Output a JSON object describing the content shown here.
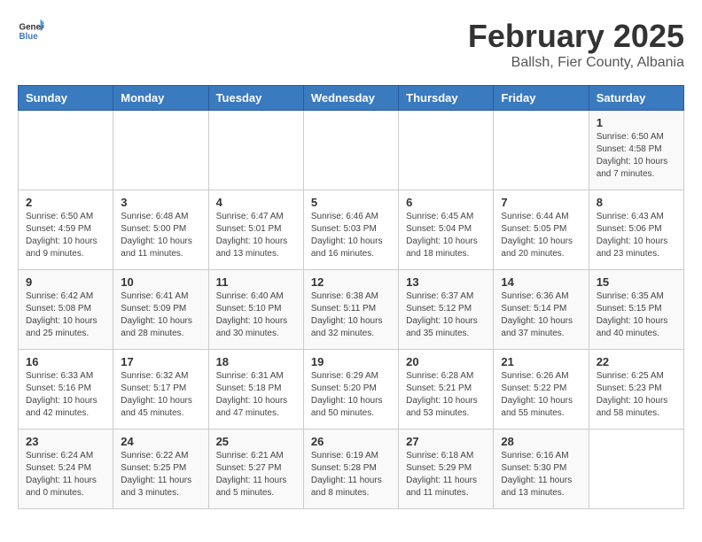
{
  "header": {
    "logo": {
      "general": "General",
      "blue": "Blue"
    },
    "title": "February 2025",
    "subtitle": "Ballsh, Fier County, Albania"
  },
  "weekdays": [
    "Sunday",
    "Monday",
    "Tuesday",
    "Wednesday",
    "Thursday",
    "Friday",
    "Saturday"
  ],
  "weeks": [
    [
      {
        "day": "",
        "info": ""
      },
      {
        "day": "",
        "info": ""
      },
      {
        "day": "",
        "info": ""
      },
      {
        "day": "",
        "info": ""
      },
      {
        "day": "",
        "info": ""
      },
      {
        "day": "",
        "info": ""
      },
      {
        "day": "1",
        "info": "Sunrise: 6:50 AM\nSunset: 4:58 PM\nDaylight: 10 hours\nand 7 minutes."
      }
    ],
    [
      {
        "day": "2",
        "info": "Sunrise: 6:50 AM\nSunset: 4:59 PM\nDaylight: 10 hours\nand 9 minutes."
      },
      {
        "day": "3",
        "info": "Sunrise: 6:48 AM\nSunset: 5:00 PM\nDaylight: 10 hours\nand 11 minutes."
      },
      {
        "day": "4",
        "info": "Sunrise: 6:47 AM\nSunset: 5:01 PM\nDaylight: 10 hours\nand 13 minutes."
      },
      {
        "day": "5",
        "info": "Sunrise: 6:46 AM\nSunset: 5:03 PM\nDaylight: 10 hours\nand 16 minutes."
      },
      {
        "day": "6",
        "info": "Sunrise: 6:45 AM\nSunset: 5:04 PM\nDaylight: 10 hours\nand 18 minutes."
      },
      {
        "day": "7",
        "info": "Sunrise: 6:44 AM\nSunset: 5:05 PM\nDaylight: 10 hours\nand 20 minutes."
      },
      {
        "day": "8",
        "info": "Sunrise: 6:43 AM\nSunset: 5:06 PM\nDaylight: 10 hours\nand 23 minutes."
      }
    ],
    [
      {
        "day": "9",
        "info": "Sunrise: 6:42 AM\nSunset: 5:08 PM\nDaylight: 10 hours\nand 25 minutes."
      },
      {
        "day": "10",
        "info": "Sunrise: 6:41 AM\nSunset: 5:09 PM\nDaylight: 10 hours\nand 28 minutes."
      },
      {
        "day": "11",
        "info": "Sunrise: 6:40 AM\nSunset: 5:10 PM\nDaylight: 10 hours\nand 30 minutes."
      },
      {
        "day": "12",
        "info": "Sunrise: 6:38 AM\nSunset: 5:11 PM\nDaylight: 10 hours\nand 32 minutes."
      },
      {
        "day": "13",
        "info": "Sunrise: 6:37 AM\nSunset: 5:12 PM\nDaylight: 10 hours\nand 35 minutes."
      },
      {
        "day": "14",
        "info": "Sunrise: 6:36 AM\nSunset: 5:14 PM\nDaylight: 10 hours\nand 37 minutes."
      },
      {
        "day": "15",
        "info": "Sunrise: 6:35 AM\nSunset: 5:15 PM\nDaylight: 10 hours\nand 40 minutes."
      }
    ],
    [
      {
        "day": "16",
        "info": "Sunrise: 6:33 AM\nSunset: 5:16 PM\nDaylight: 10 hours\nand 42 minutes."
      },
      {
        "day": "17",
        "info": "Sunrise: 6:32 AM\nSunset: 5:17 PM\nDaylight: 10 hours\nand 45 minutes."
      },
      {
        "day": "18",
        "info": "Sunrise: 6:31 AM\nSunset: 5:18 PM\nDaylight: 10 hours\nand 47 minutes."
      },
      {
        "day": "19",
        "info": "Sunrise: 6:29 AM\nSunset: 5:20 PM\nDaylight: 10 hours\nand 50 minutes."
      },
      {
        "day": "20",
        "info": "Sunrise: 6:28 AM\nSunset: 5:21 PM\nDaylight: 10 hours\nand 53 minutes."
      },
      {
        "day": "21",
        "info": "Sunrise: 6:26 AM\nSunset: 5:22 PM\nDaylight: 10 hours\nand 55 minutes."
      },
      {
        "day": "22",
        "info": "Sunrise: 6:25 AM\nSunset: 5:23 PM\nDaylight: 10 hours\nand 58 minutes."
      }
    ],
    [
      {
        "day": "23",
        "info": "Sunrise: 6:24 AM\nSunset: 5:24 PM\nDaylight: 11 hours\nand 0 minutes."
      },
      {
        "day": "24",
        "info": "Sunrise: 6:22 AM\nSunset: 5:25 PM\nDaylight: 11 hours\nand 3 minutes."
      },
      {
        "day": "25",
        "info": "Sunrise: 6:21 AM\nSunset: 5:27 PM\nDaylight: 11 hours\nand 5 minutes."
      },
      {
        "day": "26",
        "info": "Sunrise: 6:19 AM\nSunset: 5:28 PM\nDaylight: 11 hours\nand 8 minutes."
      },
      {
        "day": "27",
        "info": "Sunrise: 6:18 AM\nSunset: 5:29 PM\nDaylight: 11 hours\nand 11 minutes."
      },
      {
        "day": "28",
        "info": "Sunrise: 6:16 AM\nSunset: 5:30 PM\nDaylight: 11 hours\nand 13 minutes."
      },
      {
        "day": "",
        "info": ""
      }
    ]
  ]
}
